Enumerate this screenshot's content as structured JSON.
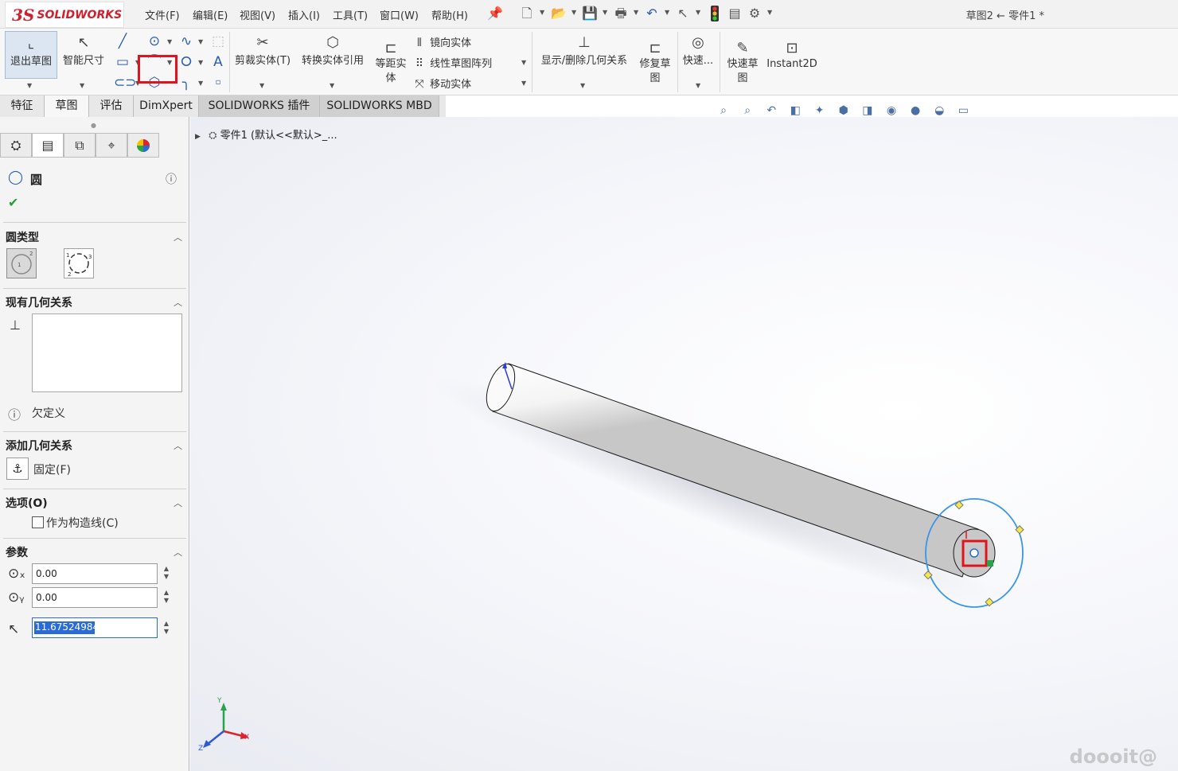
{
  "app": {
    "logo_prefix": "3S",
    "logo_text": "SOLIDWORKS",
    "document_title": "草图2 ← 零件1 *"
  },
  "menus": [
    "文件(F)",
    "编辑(E)",
    "视图(V)",
    "插入(I)",
    "工具(T)",
    "窗口(W)",
    "帮助(H)"
  ],
  "command_manager": {
    "exit_sketch": "退出草图",
    "smart_dimension": "智能尺寸",
    "trim_entities": "剪裁实体(T)",
    "convert_entities": "转换实体引用",
    "offset_entities_l1": "等距实",
    "offset_entities_l2": "体",
    "mirror_entities": "镜向实体",
    "linear_pattern": "线性草图阵列",
    "move_entities": "移动实体",
    "display_relations": "显示/删除几何关系",
    "repair_sketch_l1": "修复草",
    "repair_sketch_l2": "图",
    "quick_snaps": "快速...",
    "rapid_sketch_l1": "快速草",
    "rapid_sketch_l2": "图",
    "instant2d": "Instant2D"
  },
  "tabs": [
    "特征",
    "草图",
    "评估",
    "DimXpert",
    "SOLIDWORKS 插件",
    "SOLIDWORKS MBD"
  ],
  "property_manager": {
    "title": "圆",
    "circle_type_section": "圆类型",
    "existing_relations_section": "现有几何关系",
    "status_text": "欠定义",
    "add_relations_section": "添加几何关系",
    "fix_relation": "固定(F)",
    "options_section": "选项(O)",
    "construction_checkbox": "作为构造线(C)",
    "parameters_section": "参数",
    "center_x": "0.00",
    "center_y": "0.00",
    "radius": "11.67524984"
  },
  "tree": {
    "root_label": "零件1 (默认<<默认>_..."
  },
  "triad": {
    "x": "X",
    "y": "Y",
    "z": "Z"
  },
  "watermark": "doooit@"
}
